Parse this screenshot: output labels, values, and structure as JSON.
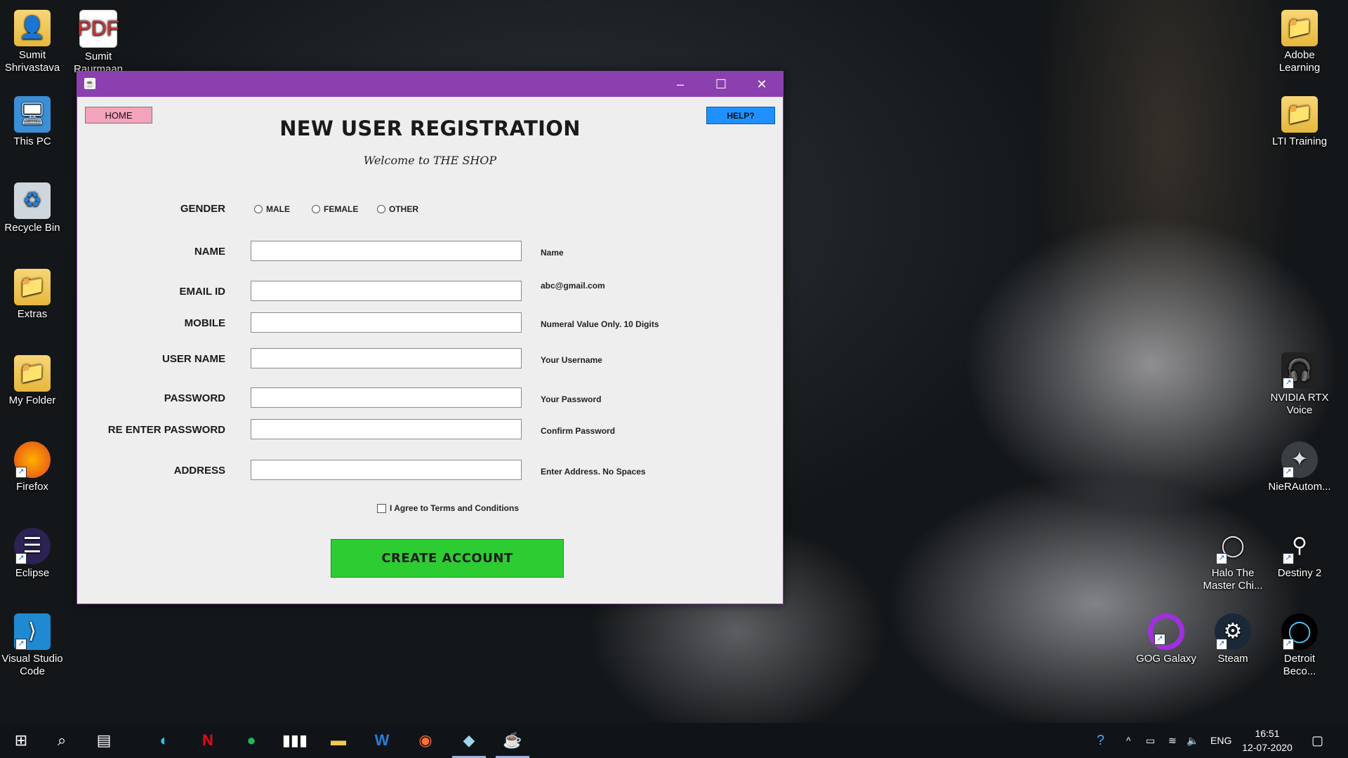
{
  "desktop": {
    "left_icons": [
      {
        "label": "Sumit Shrivastava",
        "icon": "user-folder-icon"
      },
      {
        "label": "Sumit Raurmaan",
        "icon": "document-icon"
      },
      {
        "label": "This PC",
        "icon": "computer-icon"
      },
      {
        "label": "Recycle Bin",
        "icon": "recycle-bin-icon"
      },
      {
        "label": "Extras",
        "icon": "folder-icon"
      },
      {
        "label": "My Folder",
        "icon": "folder-icon"
      },
      {
        "label": "Firefox",
        "icon": "firefox-icon"
      },
      {
        "label": "Eclipse",
        "icon": "eclipse-icon"
      },
      {
        "label": "Visual Studio Code",
        "icon": "vscode-icon"
      }
    ],
    "right_icons": [
      {
        "label": "Adobe Learning",
        "icon": "folder-icon"
      },
      {
        "label": "LTI Training",
        "icon": "folder-icon"
      },
      {
        "label": "NVIDIA RTX Voice",
        "icon": "nvidia-icon"
      },
      {
        "label": "NieRAutom...",
        "icon": "game-icon"
      },
      {
        "label": "Halo The Master Chi...",
        "icon": "halo-icon"
      },
      {
        "label": "Destiny 2",
        "icon": "destiny-icon"
      },
      {
        "label": "GOG Galaxy",
        "icon": "gog-icon"
      },
      {
        "label": "Steam",
        "icon": "steam-icon"
      },
      {
        "label": "Detroit Beco...",
        "icon": "detroit-icon"
      }
    ]
  },
  "window": {
    "title_bar_color": "#8c3fae",
    "home_label": "HOME",
    "help_label": "HELP?",
    "title": "NEW USER REGISTRATION",
    "subtitle": "Welcome to THE SHOP",
    "gender": {
      "label": "GENDER",
      "options": [
        "MALE",
        "FEMALE",
        "OTHER"
      ]
    },
    "fields": [
      {
        "label": "NAME",
        "value": "",
        "hint": "Name"
      },
      {
        "label": "EMAIL ID",
        "value": "",
        "hint": "abc@gmail.com"
      },
      {
        "label": "MOBILE",
        "value": "",
        "hint": "Numeral Value Only. 10 Digits"
      },
      {
        "label": "USER NAME",
        "value": "",
        "hint": "Your Username"
      },
      {
        "label": "PASSWORD",
        "value": "",
        "hint": "Your Password"
      },
      {
        "label": "RE ENTER PASSWORD",
        "value": "",
        "hint": "Confirm Password"
      },
      {
        "label": "ADDRESS",
        "value": "",
        "hint": "Enter Address. No Spaces"
      }
    ],
    "terms_label": "I Agree to Terms and Conditions",
    "create_label": "CREATE ACCOUNT",
    "create_color": "#2ecc33",
    "help_color": "#1e90ff",
    "home_color": "#f4a3bd"
  },
  "taskbar": {
    "apps": [
      "start-icon",
      "search-icon",
      "task-view-icon",
      "edge-icon",
      "netflix-icon",
      "spotify-icon",
      "audio-app-icon",
      "file-explorer-icon",
      "word-icon",
      "firefox-icon",
      "notes-icon",
      "java-icon"
    ],
    "language": "ENG",
    "time": "16:51",
    "date": "12-07-2020"
  }
}
